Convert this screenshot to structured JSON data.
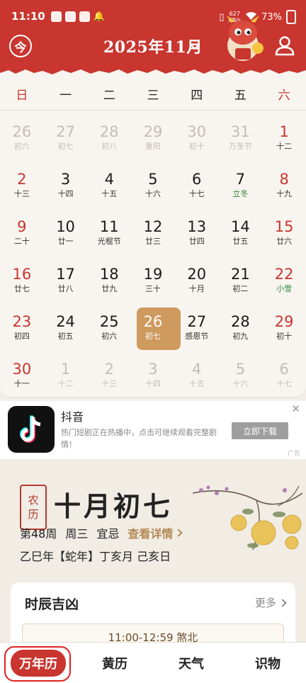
{
  "status_bar": {
    "time": "11:10",
    "net_speed_value": "627",
    "net_speed_unit": "KB/s",
    "battery": "73%"
  },
  "header": {
    "today_label": "今",
    "month_title": "2025年11月"
  },
  "calendar": {
    "weekdays": [
      "日",
      "一",
      "二",
      "三",
      "四",
      "五",
      "六"
    ],
    "weeks": [
      [
        {
          "day": "26",
          "lunar": "初六"
        },
        {
          "day": "27",
          "lunar": "初七"
        },
        {
          "day": "28",
          "lunar": "初八"
        },
        {
          "day": "29",
          "lunar": "重阳"
        },
        {
          "day": "30",
          "lunar": "初十"
        },
        {
          "day": "31",
          "lunar": "万圣节"
        },
        {
          "day": "1",
          "lunar": "十二"
        }
      ],
      [
        {
          "day": "2",
          "lunar": "十三"
        },
        {
          "day": "3",
          "lunar": "十四"
        },
        {
          "day": "4",
          "lunar": "十五"
        },
        {
          "day": "5",
          "lunar": "十六"
        },
        {
          "day": "6",
          "lunar": "十七"
        },
        {
          "day": "7",
          "lunar": "立冬"
        },
        {
          "day": "8",
          "lunar": "十九"
        }
      ],
      [
        {
          "day": "9",
          "lunar": "二十"
        },
        {
          "day": "10",
          "lunar": "廿一"
        },
        {
          "day": "11",
          "lunar": "光棍节"
        },
        {
          "day": "12",
          "lunar": "廿三"
        },
        {
          "day": "13",
          "lunar": "廿四"
        },
        {
          "day": "14",
          "lunar": "廿五"
        },
        {
          "day": "15",
          "lunar": "廿六"
        }
      ],
      [
        {
          "day": "16",
          "lunar": "廿七"
        },
        {
          "day": "17",
          "lunar": "廿八"
        },
        {
          "day": "18",
          "lunar": "廿九"
        },
        {
          "day": "19",
          "lunar": "三十"
        },
        {
          "day": "20",
          "lunar": "十月"
        },
        {
          "day": "21",
          "lunar": "初二"
        },
        {
          "day": "22",
          "lunar": "小雪"
        }
      ],
      [
        {
          "day": "23",
          "lunar": "初四"
        },
        {
          "day": "24",
          "lunar": "初五"
        },
        {
          "day": "25",
          "lunar": "初六"
        },
        {
          "day": "26",
          "lunar": "初七"
        },
        {
          "day": "27",
          "lunar": "感恩节"
        },
        {
          "day": "28",
          "lunar": "初九"
        },
        {
          "day": "29",
          "lunar": "初十"
        }
      ],
      [
        {
          "day": "30",
          "lunar": "十一"
        },
        {
          "day": "1",
          "lunar": "十二"
        },
        {
          "day": "2",
          "lunar": "十三"
        },
        {
          "day": "3",
          "lunar": "十四"
        },
        {
          "day": "4",
          "lunar": "十五"
        },
        {
          "day": "5",
          "lunar": "十六"
        },
        {
          "day": "6",
          "lunar": "十七"
        }
      ]
    ]
  },
  "ad": {
    "title": "抖音",
    "description": "热门短剧正在热播中，点击可继续观看完整剧情！",
    "button": "立即下载",
    "close": "✕",
    "tag": "广告"
  },
  "lunar": {
    "seal_top": "农",
    "seal_bottom": "历",
    "date": "十月初七",
    "week": "第48周",
    "weekday": "周三",
    "yiji": "宜忌",
    "detail_link": "查看详情",
    "ganzhi": "乙巳年【蛇年】丁亥月 己亥日"
  },
  "shichen": {
    "title": "时辰吉凶",
    "more": "更多",
    "slot": "11:00-12:59 煞北"
  },
  "tabs": [
    "万年历",
    "黄历",
    "天气",
    "识物"
  ],
  "colors": {
    "brand_red": "#c8362f",
    "selected_gold": "#cf9a5d",
    "term_green": "#2f8a3a"
  }
}
